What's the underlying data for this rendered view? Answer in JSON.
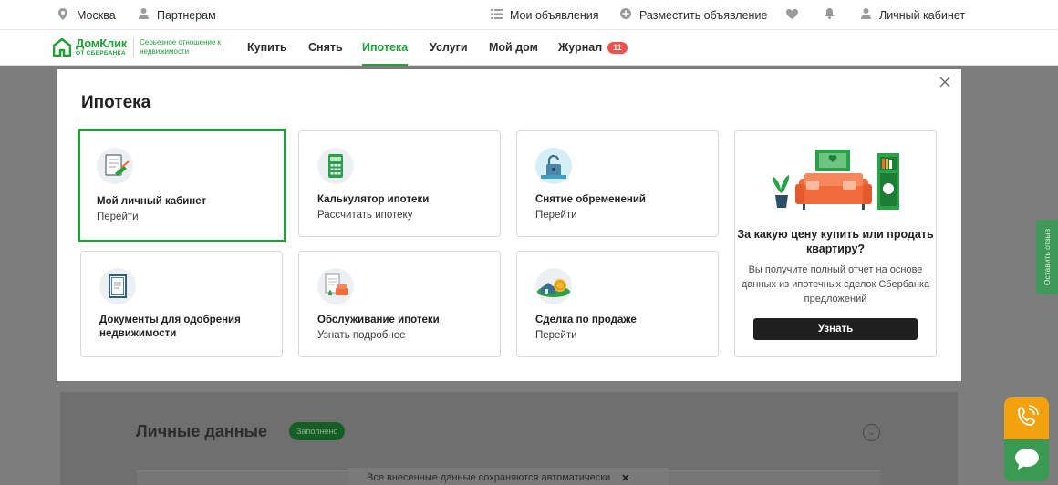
{
  "topbar": {
    "city": "Москва",
    "partners": "Партнерам",
    "my_ads": "Мои объявления",
    "post_ad": "Разместить объявление",
    "cabinet": "Личный кабинет"
  },
  "brand": {
    "name": "ДомКлик",
    "sub": "ОТ СБЕРБАНКА",
    "tagline": "Серьезное отношение к недвижимости"
  },
  "nav": {
    "items": [
      {
        "label": "Купить"
      },
      {
        "label": "Снять"
      },
      {
        "label": "Ипотека",
        "active": true
      },
      {
        "label": "Услуги"
      },
      {
        "label": "Мой дом"
      },
      {
        "label": "Журнал",
        "badge": "11"
      }
    ]
  },
  "modal": {
    "title": "Ипотека",
    "cards": [
      {
        "title": "Мой личный кабинет",
        "sub": "Перейти",
        "icon": "document-pen-icon",
        "selected": true
      },
      {
        "title": "Калькулятор ипотеки",
        "sub": "Рассчитать ипотеку",
        "icon": "calculator-icon"
      },
      {
        "title": "Снятие обременений",
        "sub": "Перейти",
        "icon": "padlock-icon"
      },
      {
        "title": "Документы для одобрения недвижимости",
        "sub": "",
        "icon": "certificate-icon"
      },
      {
        "title": "Обслуживание ипотеки",
        "sub": "Узнать подробнее",
        "icon": "document-chair-icon"
      },
      {
        "title": "Сделка по продаже",
        "sub": "Перейти",
        "icon": "house-coin-icon"
      }
    ],
    "promo": {
      "title": "За какую цену купить или продать квартиру?",
      "text": "Вы получите полный отчет на основе данных из ипотечных сделок Сбербанка предложений",
      "button": "Узнать"
    }
  },
  "background": {
    "section_title": "Личные данные",
    "status_badge": "Заполнено",
    "autosave_note": "Все внесенные данные сохраняются автоматически"
  },
  "feedback_label": "Оставить отзыв",
  "colors": {
    "brand_green": "#21a038",
    "badge_red": "#f2504b",
    "phone_orange": "#f2a20f"
  }
}
